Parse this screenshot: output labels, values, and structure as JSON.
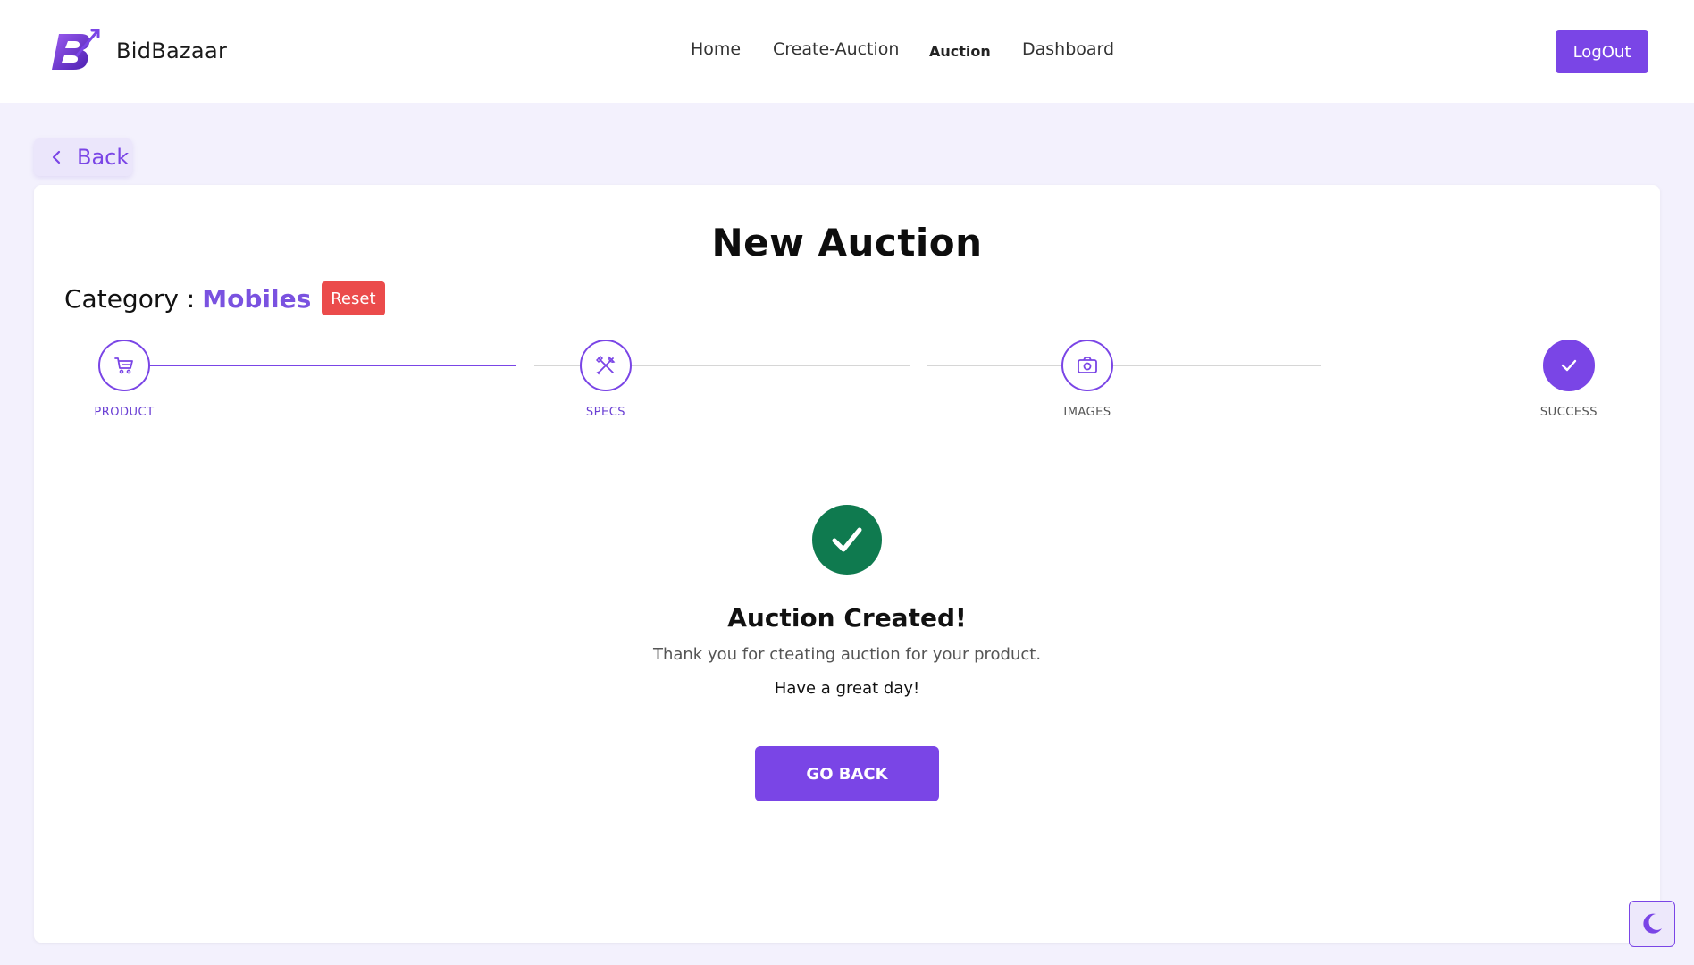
{
  "brand": {
    "name": "BidBazaar",
    "logo_icon": "bidbazaar-logo-icon"
  },
  "nav": {
    "links": [
      "Home",
      "Create-Auction",
      "Auction",
      "Dashboard"
    ],
    "active": "Auction",
    "logout_label": "LogOut"
  },
  "back_label": "Back",
  "page": {
    "title": "New Auction",
    "category_label": "Category :",
    "category_value": "Mobiles",
    "reset_label": "Reset"
  },
  "stepper": {
    "steps": [
      {
        "label": "PRODUCT",
        "icon": "cart-icon",
        "active": true
      },
      {
        "label": "SPECS",
        "icon": "tools-icon",
        "active": true
      },
      {
        "label": "IMAGES",
        "icon": "camera-icon",
        "active": false
      },
      {
        "label": "SUCCESS",
        "icon": "check-icon",
        "active": false
      }
    ]
  },
  "success": {
    "title": "Auction Created!",
    "message": "Thank you for cteating auction for your product.",
    "sub": "Have a great day!",
    "button_label": "GO BACK"
  },
  "colors": {
    "accent": "#7a45e6",
    "success": "#0f7a4f",
    "danger": "#eb4b4b",
    "background": "#f3f1fd"
  },
  "theme_toggle_icon": "moon-icon"
}
